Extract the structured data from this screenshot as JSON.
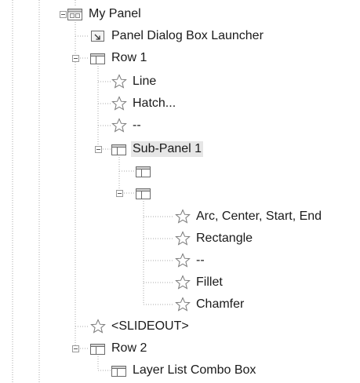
{
  "tree": {
    "nodes": [
      {
        "id": "my-panel",
        "label": "My Panel",
        "icon": "panel-icon",
        "level": 0,
        "expander": "collapse"
      },
      {
        "id": "launcher",
        "label": "Panel Dialog Box Launcher",
        "icon": "dialog-launcher-icon",
        "level": 1
      },
      {
        "id": "row1",
        "label": "Row 1",
        "icon": "row-icon",
        "level": 1,
        "expander": "collapse"
      },
      {
        "id": "line",
        "label": "Line",
        "icon": "star-icon",
        "level": 2
      },
      {
        "id": "hatch",
        "label": "Hatch...",
        "icon": "star-icon",
        "level": 2
      },
      {
        "id": "sep1",
        "label": "--",
        "icon": "star-icon",
        "level": 2
      },
      {
        "id": "subpanel1",
        "label": "Sub-Panel 1",
        "icon": "row-icon",
        "level": 2,
        "expander": "collapse",
        "selected": true
      },
      {
        "id": "subrow1",
        "label": "",
        "icon": "row-icon",
        "level": 3
      },
      {
        "id": "subrow2",
        "label": "",
        "icon": "row-icon",
        "level": 3,
        "expander": "collapse"
      },
      {
        "id": "arc",
        "label": "Arc, Center, Start, End",
        "icon": "star-icon",
        "level": 4
      },
      {
        "id": "rect",
        "label": "Rectangle",
        "icon": "star-icon",
        "level": 4
      },
      {
        "id": "sep2",
        "label": "--",
        "icon": "star-icon",
        "level": 4
      },
      {
        "id": "fillet",
        "label": "Fillet",
        "icon": "star-icon",
        "level": 4
      },
      {
        "id": "chamfer",
        "label": "Chamfer",
        "icon": "star-icon",
        "level": 4
      },
      {
        "id": "slideout",
        "label": "<SLIDEOUT>",
        "icon": "star-icon",
        "level": 1
      },
      {
        "id": "row2",
        "label": "Row 2",
        "icon": "row-icon",
        "level": 1,
        "expander": "collapse"
      },
      {
        "id": "layerlist",
        "label": "Layer List Combo Box",
        "icon": "row-icon",
        "level": 2
      }
    ]
  }
}
